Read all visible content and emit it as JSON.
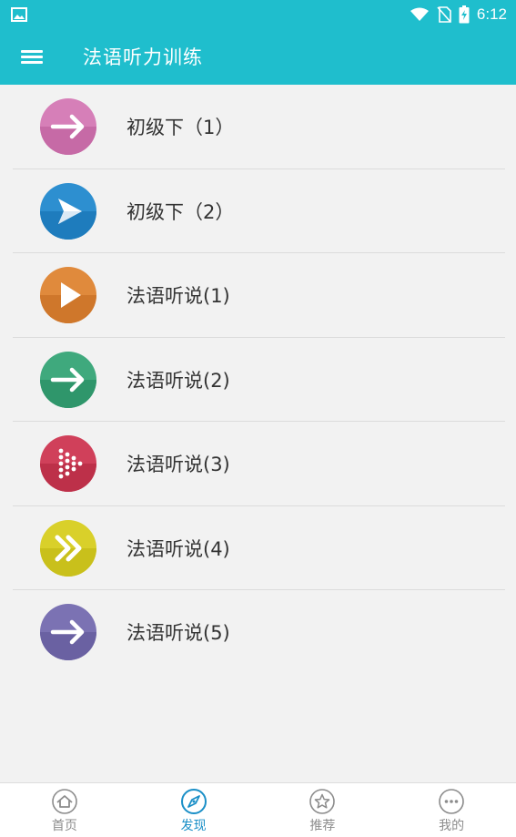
{
  "status_bar": {
    "time": "6:12",
    "icons": [
      "image-icon",
      "wifi-icon",
      "no-sim-icon",
      "battery-icon"
    ]
  },
  "header": {
    "title": "法语听力训练",
    "menu_icon": "hamburger-menu-icon"
  },
  "list": {
    "items": [
      {
        "label": "初级下（1）",
        "icon": "arrow-right-icon",
        "color": "#d67fb8"
      },
      {
        "label": "初级下（2）",
        "icon": "paper-plane-icon",
        "color": "#2d8fd0"
      },
      {
        "label": "法语听说(1)",
        "icon": "play-icon",
        "color": "#e08a3c"
      },
      {
        "label": "法语听说(2)",
        "icon": "arrow-right-icon",
        "color": "#3fa97d"
      },
      {
        "label": "法语听说(3)",
        "icon": "dotted-play-icon",
        "color": "#d0405a"
      },
      {
        "label": "法语听说(4)",
        "icon": "double-chevron-icon",
        "color": "#d9d02a"
      },
      {
        "label": "法语听说(5)",
        "icon": "arrow-right-icon",
        "color": "#7b72b3"
      }
    ]
  },
  "bottom_nav": {
    "items": [
      {
        "label": "首页",
        "icon": "home-icon",
        "active": false
      },
      {
        "label": "发现",
        "icon": "compass-icon",
        "active": true
      },
      {
        "label": "推荐",
        "icon": "star-icon",
        "active": false
      },
      {
        "label": "我的",
        "icon": "more-dots-icon",
        "active": false
      }
    ]
  },
  "colors": {
    "accent": "#1fbecd",
    "active_tab": "#1a8fc7",
    "inactive_tab": "#8c8c8c"
  }
}
